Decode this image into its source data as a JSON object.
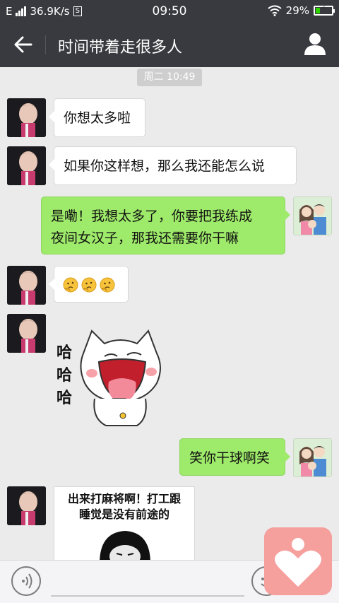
{
  "status": {
    "carrier": "E",
    "speed": "36.9K/s",
    "sim_label": "S",
    "time": "09:50",
    "battery": "29%",
    "battery_level": 0.29
  },
  "chat": {
    "title": "时间带着走很多人",
    "timestamp": "周二 10:49"
  },
  "messages": [
    {
      "from": "other",
      "text": "你想太多啦"
    },
    {
      "from": "other",
      "text": "如果你这样想，那么我还能怎么说"
    },
    {
      "from": "me",
      "lines": [
        "是嘞！我想太多了，你要把我练成",
        "夜间女汉子，那我还需要你干嘛"
      ]
    },
    {
      "from": "other",
      "emoji_count": 3,
      "emoji": "thinking-face-icon"
    },
    {
      "from": "other",
      "sticker": "laughing-cat-sticker",
      "sticker_text": [
        "哈",
        "哈",
        "哈"
      ]
    },
    {
      "from": "me",
      "text": "笑你干球啊笑"
    },
    {
      "from": "other",
      "meme_lines": [
        "出来打麻将啊！打工跟",
        "睡觉是没有前途的"
      ]
    }
  ],
  "colors": {
    "nav_bg": "#393a3f",
    "chat_bg": "#ebebeb",
    "out_bubble": "#9eea6a",
    "in_bubble": "#ffffff",
    "float_app": "#f6a09e"
  }
}
